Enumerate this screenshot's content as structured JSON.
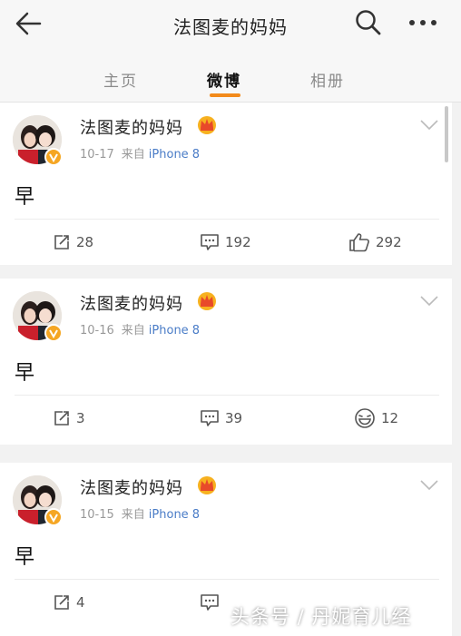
{
  "header": {
    "title": "法图麦的妈妈",
    "back_icon": "arrow-left-icon",
    "search_icon": "search-icon",
    "more_icon": "more-dots-icon"
  },
  "tabs": [
    {
      "label": "主页"
    },
    {
      "label": "微博",
      "active": true
    },
    {
      "label": "相册"
    }
  ],
  "accent_color": "#f28a1a",
  "posts": [
    {
      "author": "法图麦的妈妈",
      "date": "10-17",
      "from_label": "来自",
      "source": "iPhone 8",
      "content": "早",
      "reposts": "28",
      "comments": "192",
      "likes": "292",
      "like_icon": "thumbs-up-icon"
    },
    {
      "author": "法图麦的妈妈",
      "date": "10-16",
      "from_label": "来自",
      "source": "iPhone 8",
      "content": "早",
      "reposts": "3",
      "comments": "39",
      "likes": "12",
      "like_icon": "laughing-face-icon"
    },
    {
      "author": "法图麦的妈妈",
      "date": "10-15",
      "from_label": "来自",
      "source": "iPhone 8",
      "content": "早",
      "reposts": "4",
      "comments": "",
      "likes": ""
    }
  ],
  "watermark": "头条号 / 丹妮育儿经"
}
